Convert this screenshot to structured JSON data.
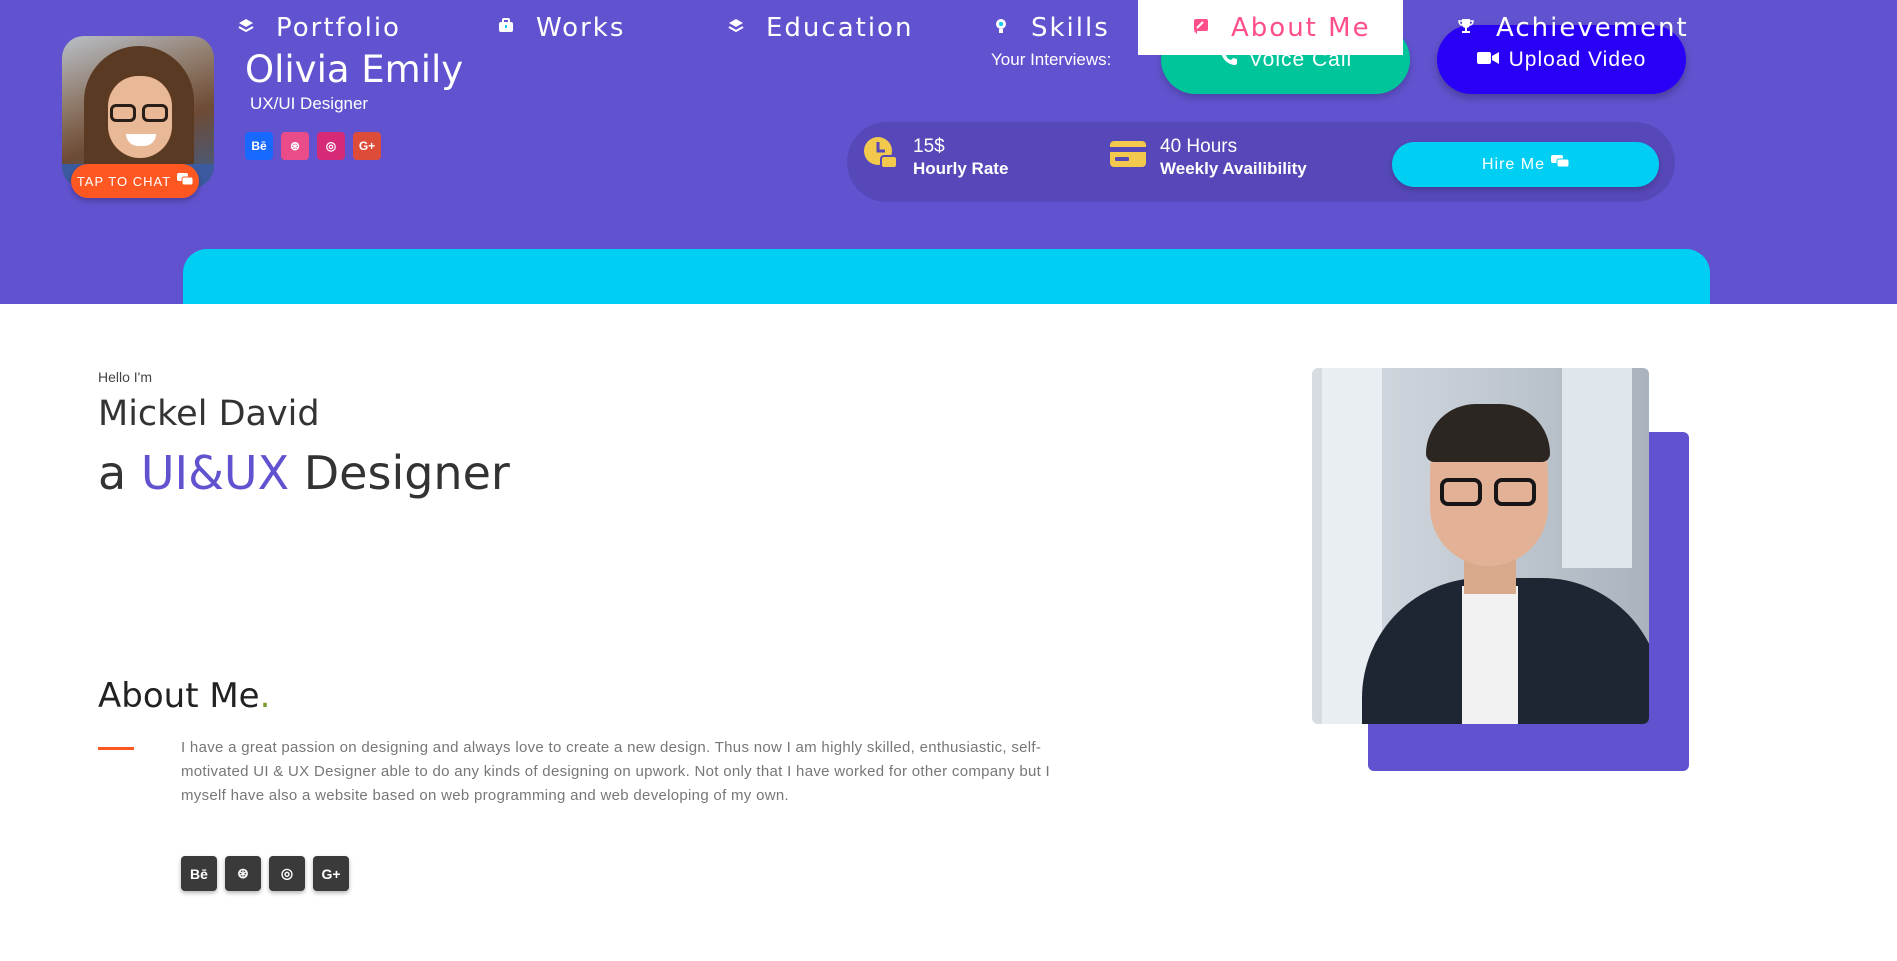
{
  "header": {
    "profile_name": "Olivia Emily",
    "profile_role": "UX/UI Designer",
    "chat_button": "TAP TO CHAT",
    "mini_social": [
      {
        "label": "Bē",
        "icon": "behance-icon",
        "color": "#1769ff"
      },
      {
        "label": "⊛",
        "icon": "dribbble-icon",
        "color": "#ea4c89"
      },
      {
        "label": "◎",
        "icon": "instagram-icon",
        "color": "#d62976"
      },
      {
        "label": "G+",
        "icon": "google-plus-icon",
        "color": "#dd4b39"
      }
    ],
    "interviews_label": "Your Interviews:",
    "voice_call": "Voice Call",
    "upload_video": "Upload Video",
    "rate_value": "15$",
    "rate_label": "Hourly Rate",
    "hours_value": "40 Hours",
    "hours_label": "Weekly Availibility",
    "hire_button": "Hire Me"
  },
  "tabs": [
    {
      "label": "Portfolio",
      "icon": "layers-icon"
    },
    {
      "label": "Works",
      "icon": "briefcase-icon"
    },
    {
      "label": "Education",
      "icon": "layers-icon"
    },
    {
      "label": "Skills",
      "icon": "lightbulb-icon"
    },
    {
      "label": "About Me",
      "icon": "edit-icon",
      "active": true
    },
    {
      "label": "Achievement",
      "icon": "trophy-icon"
    }
  ],
  "main": {
    "hello": "Hello I'm",
    "name": "Mickel David",
    "title_prefix": "a",
    "title_accent": "UI&UX",
    "title_suffix": "Designer",
    "about_heading": "About Me",
    "about_dot": ".",
    "about_text": "I have a great passion on designing and always love to create a new design. Thus now I am highly skilled, enthusiastic, self- motivated UI & UX Designer able to do any kinds of designing on upwork. Not only that I have worked for other company but I myself have also a website based on web programming and web developing of my own.",
    "social": [
      {
        "label": "Bē",
        "icon": "behance-icon"
      },
      {
        "label": "⊛",
        "icon": "dribbble-icon"
      },
      {
        "label": "◎",
        "icon": "instagram-icon"
      },
      {
        "label": "G+",
        "icon": "google-plus-icon"
      }
    ]
  },
  "colors": {
    "primary": "#6153cf",
    "cyan": "#00cff3",
    "green": "#00c49a",
    "blue": "#2900f5",
    "orange": "#ff5722",
    "pink": "#ff4f8a"
  }
}
